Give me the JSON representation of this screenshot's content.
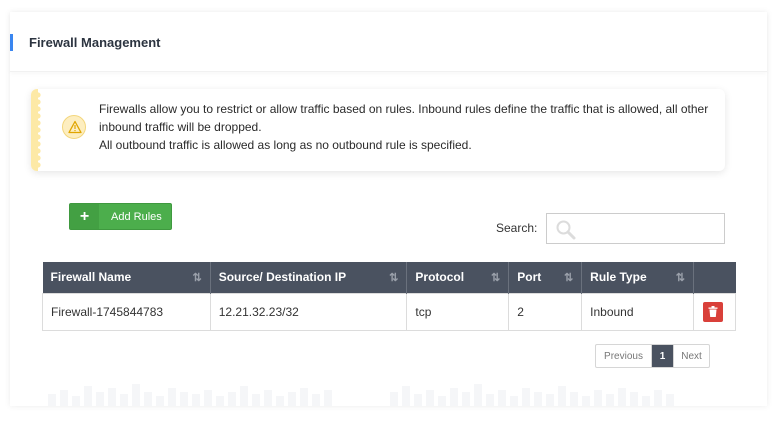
{
  "header": {
    "title": "Firewall Management"
  },
  "alert": {
    "lines": [
      "Firewalls allow you to restrict or allow traffic based on rules. Inbound rules define the traffic that is allowed, all other inbound traffic will be dropped.",
      "All outbound traffic is allowed as long as no outbound rule is specified."
    ],
    "icon": "warning-icon"
  },
  "toolbar": {
    "add_label": "Add Rules",
    "add_icon": "+",
    "search_label": "Search:",
    "search_value": ""
  },
  "table": {
    "columns": [
      "Firewall Name",
      "Source/ Destination IP",
      "Protocol",
      "Port",
      "Rule Type"
    ],
    "rows": [
      {
        "name": "Firewall-1745844783",
        "ip": "12.21.32.23/32",
        "protocol": "tcp",
        "port": "2",
        "rule_type": "Inbound"
      }
    ]
  },
  "pagination": {
    "prev": "Previous",
    "current": "1",
    "next": "Next"
  },
  "colors": {
    "accent": "#3a86f0",
    "header_bg": "#4a5260",
    "add_button": "#4cae4c",
    "delete_button": "#d9403a",
    "alert_stripe": "#fde9a6"
  }
}
